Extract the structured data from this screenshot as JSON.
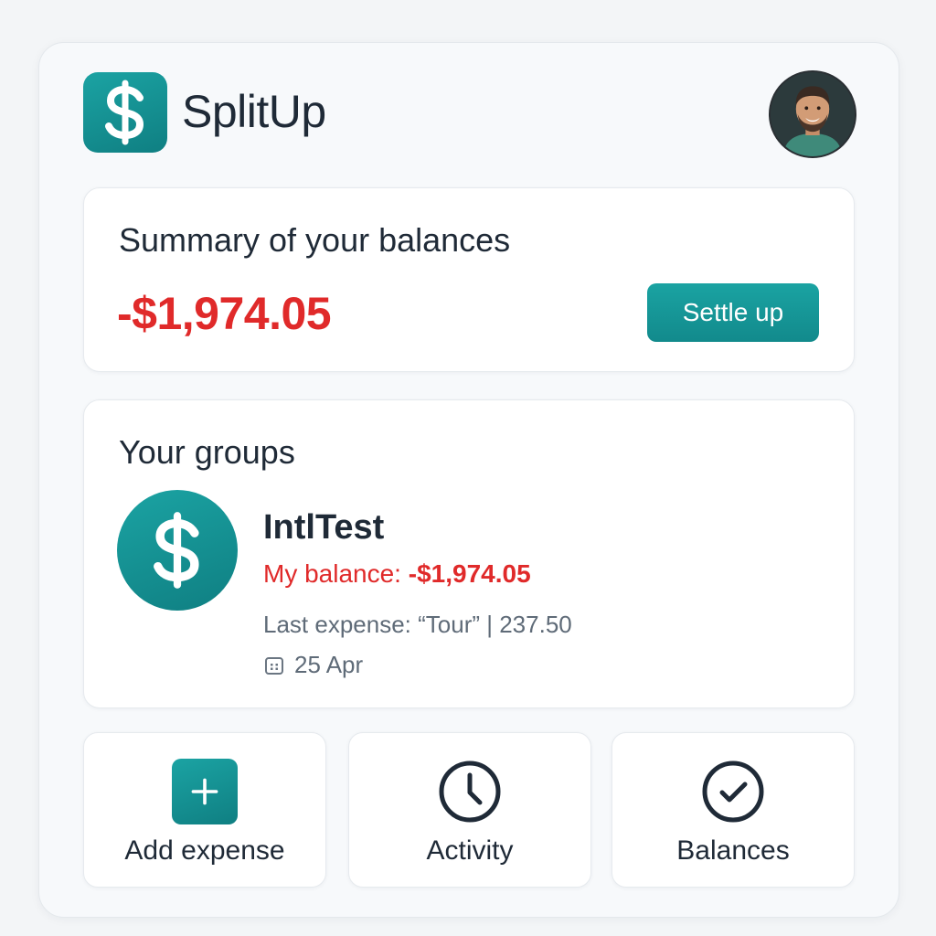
{
  "app": {
    "name": "SplitUp",
    "accent_color": "#149394",
    "negative_color": "#e02a2a"
  },
  "header": {
    "logo_icon": "dollar-icon",
    "avatar_icon": "user-avatar"
  },
  "summary": {
    "title": "Summary of your balances",
    "amount": "-$1,974.05",
    "settle_label": "Settle up"
  },
  "groups": {
    "title": "Your groups",
    "items": [
      {
        "name": "IntlTest",
        "balance_label": "My balance: ",
        "balance_amount": "-$1,974.05",
        "last_expense": "Last expense: “Tour”  |  237.50",
        "date": "25 Apr",
        "icon": "dollar-icon"
      }
    ]
  },
  "actions": [
    {
      "label": "Add expense",
      "icon": "plus-icon"
    },
    {
      "label": "Activity",
      "icon": "clock-icon"
    },
    {
      "label": "Balances",
      "icon": "check-circle-icon"
    }
  ]
}
